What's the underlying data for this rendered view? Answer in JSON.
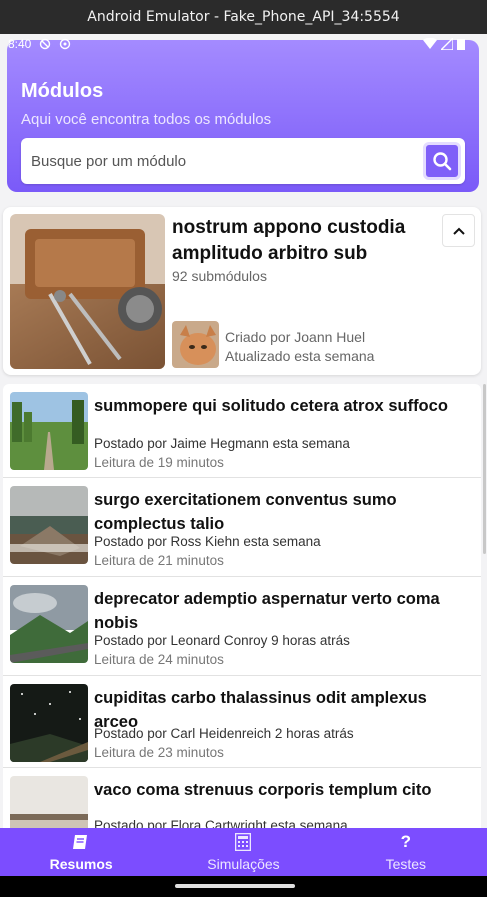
{
  "window": {
    "title": "Android Emulator - Fake_Phone_API_34:5554"
  },
  "status_bar": {
    "time": "8:40"
  },
  "header": {
    "title": "Módulos",
    "subtitle": "Aqui você encontra todos os módulos",
    "search_placeholder": "Busque por um módulo",
    "search_icon": "search-icon",
    "gradient_top": "#a48bff",
    "gradient_bottom": "#7a5af8"
  },
  "module": {
    "title": "nostrum appono custodia amplitudo arbitro sub",
    "submodules": "92 submódulos",
    "created_by": "Criado por Joann Huel",
    "updated": "Atualizado esta semana"
  },
  "posts": [
    {
      "title": "summopere qui solitudo cetera atrox suffoco",
      "by": "Postado por Jaime Hegmann esta semana",
      "read": "Leitura de 19 minutos"
    },
    {
      "title": "surgo exercitationem conventus sumo complectus talio",
      "by": "Postado por Ross Kiehn esta semana",
      "read": "Leitura de 21 minutos"
    },
    {
      "title": "deprecator ademptio aspernatur verto coma nobis",
      "by": "Postado por Leonard Conroy 9 horas atrás",
      "read": "Leitura de 24 minutos"
    },
    {
      "title": "cupiditas carbo thalassinus odit amplexus arceo",
      "by": "Postado por Carl Heidenreich 2 horas atrás",
      "read": "Leitura de 23 minutos"
    },
    {
      "title": "vaco coma strenuus corporis templum cito",
      "by": "Postado por Flora Cartwright esta semana",
      "read": ""
    }
  ],
  "nav": [
    {
      "label": "Resumos",
      "icon": "book-icon",
      "active": true
    },
    {
      "label": "Simulações",
      "icon": "calculator-icon",
      "active": false
    },
    {
      "label": "Testes",
      "icon": "question-icon",
      "active": false
    }
  ],
  "colors": {
    "accent": "#7c4dff",
    "search_button": "#7f5ff8"
  }
}
